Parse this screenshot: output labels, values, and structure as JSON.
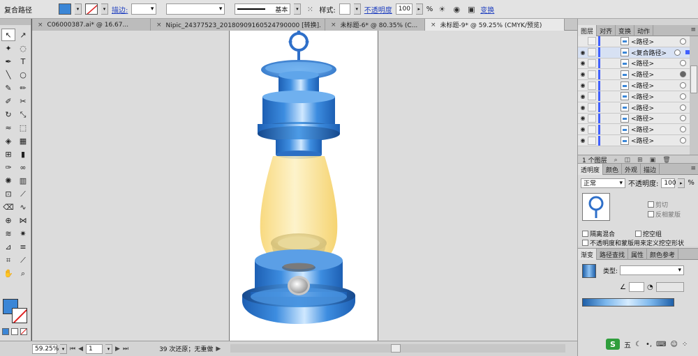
{
  "control_bar": {
    "object_type": "复合路径",
    "fill_color": "#3b86d6",
    "stroke_label": "描边:",
    "stroke_profile": "基本",
    "style_label": "样式:",
    "opacity_label": "不透明度",
    "opacity_value": "100",
    "opacity_unit": "%",
    "transform_label": "变换"
  },
  "doc_tabs": [
    {
      "label": "C06000387.ai* @ 16.67..."
    },
    {
      "label": "Nipic_24377523_20180909160524790000 [转换].ai*"
    },
    {
      "label": "未标题-6* @ 80.35% (C..."
    },
    {
      "label": "未标题-9* @ 59.25% (CMYK/预览)"
    }
  ],
  "tools": [
    {
      "icon": "selection-tool-icon",
      "glyph": "↖",
      "selected": true
    },
    {
      "icon": "direct-selection-tool-icon",
      "glyph": "↗"
    },
    {
      "icon": "magic-wand-tool-icon",
      "glyph": "✦"
    },
    {
      "icon": "lasso-tool-icon",
      "glyph": "◌"
    },
    {
      "icon": "pen-tool-icon",
      "glyph": "✒"
    },
    {
      "icon": "type-tool-icon",
      "glyph": "T"
    },
    {
      "icon": "line-tool-icon",
      "glyph": "╲"
    },
    {
      "icon": "ellipse-tool-icon",
      "glyph": "○"
    },
    {
      "icon": "paintbrush-tool-icon",
      "glyph": "✎"
    },
    {
      "icon": "pencil-tool-icon",
      "glyph": "✏"
    },
    {
      "icon": "blob-brush-tool-icon",
      "glyph": "✐"
    },
    {
      "icon": "scissors-tool-icon",
      "glyph": "✂"
    },
    {
      "icon": "rotate-tool-icon",
      "glyph": "↻"
    },
    {
      "icon": "scale-tool-icon",
      "glyph": "⤡"
    },
    {
      "icon": "warp-tool-icon",
      "glyph": "≈"
    },
    {
      "icon": "free-transform-tool-icon",
      "glyph": "⬚"
    },
    {
      "icon": "shape-builder-tool-icon",
      "glyph": "◈"
    },
    {
      "icon": "perspective-grid-tool-icon",
      "glyph": "▦"
    },
    {
      "icon": "mesh-tool-icon",
      "glyph": "⊞"
    },
    {
      "icon": "gradient-tool-icon",
      "glyph": "▮"
    },
    {
      "icon": "eyedropper-tool-icon",
      "glyph": "✑"
    },
    {
      "icon": "blend-tool-icon",
      "glyph": "∞"
    },
    {
      "icon": "symbol-sprayer-tool-icon",
      "glyph": "✺"
    },
    {
      "icon": "column-graph-tool-icon",
      "glyph": "▥"
    },
    {
      "icon": "artboard-tool-icon",
      "glyph": "⊡"
    },
    {
      "icon": "slice-tool-icon",
      "glyph": "⟋"
    },
    {
      "icon": "eraser-tool-icon",
      "glyph": "⌫"
    },
    {
      "icon": "path-eraser-tool-icon",
      "glyph": "∿"
    },
    {
      "icon": "puppet-warp-tool-icon",
      "glyph": "⊕"
    },
    {
      "icon": "width-tool-icon",
      "glyph": "⋈"
    },
    {
      "icon": "liquify-tool-icon",
      "glyph": "≋"
    },
    {
      "icon": "crystallize-tool-icon",
      "glyph": "✷"
    },
    {
      "icon": "graph-tool-icon",
      "glyph": "⊿"
    },
    {
      "icon": "chart-tool-icon",
      "glyph": "≡"
    },
    {
      "icon": "crop-tool-icon",
      "glyph": "⌗"
    },
    {
      "icon": "knife-tool-icon",
      "glyph": "⟋"
    },
    {
      "icon": "hand-tool-icon",
      "glyph": "✋"
    },
    {
      "icon": "zoom-tool-icon",
      "glyph": "⌕"
    }
  ],
  "status_bar": {
    "zoom": "59.25%",
    "artboard": "1",
    "message": "39 次还原；无重做"
  },
  "layers_panel": {
    "tabs": [
      "图层",
      "对齐",
      "变换",
      "动作"
    ],
    "rows": [
      {
        "name": "<路径>",
        "target": "off"
      },
      {
        "name": "<复合路径>",
        "target": "double",
        "selected": true
      },
      {
        "name": "<路径>",
        "target": "off"
      },
      {
        "name": "<路径>",
        "target": "on"
      },
      {
        "name": "<路径>",
        "target": "off"
      },
      {
        "name": "<路径>",
        "target": "off"
      },
      {
        "name": "<路径>",
        "target": "off"
      },
      {
        "name": "<路径>",
        "target": "off"
      },
      {
        "name": "<路径>",
        "target": "off"
      },
      {
        "name": "<路径>",
        "target": "off"
      }
    ],
    "footer": "1 个图层"
  },
  "transparency_panel": {
    "tabs": [
      "透明度",
      "颜色",
      "外观",
      "描边"
    ],
    "blend_mode": "正常",
    "opacity_label": "不透明度:",
    "opacity_value": "100",
    "opacity_unit": "%",
    "clip_label": "剪切",
    "invert_label": "反相蒙版",
    "isolate_label": "隔离混合",
    "knockout_label": "挖空组",
    "mask_label": "不透明度和蒙版用来定义挖空形状"
  },
  "gradient_panel": {
    "tabs": [
      "渐变",
      "路径查找",
      "属性",
      "颜色参考"
    ],
    "type_label": "类型:"
  },
  "taskbar": {
    "ime_label": "五"
  }
}
